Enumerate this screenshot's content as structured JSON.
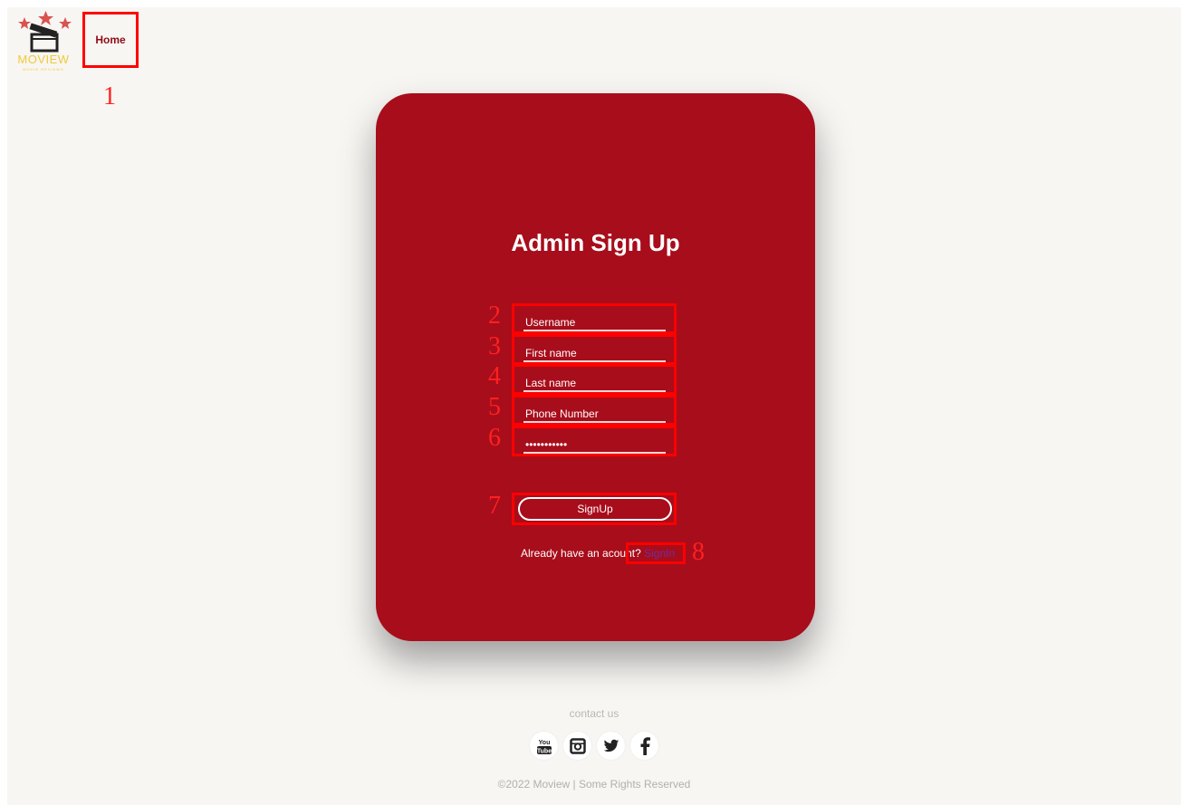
{
  "header": {
    "logo_text": "MOVIEW",
    "logo_subtext": "MOVIE REVIEWS",
    "home_label": "Home"
  },
  "form": {
    "title": "Admin Sign Up",
    "username_placeholder": "Username",
    "firstname_placeholder": "First name",
    "lastname_placeholder": "Last name",
    "phone_placeholder": "Phone Number",
    "password_value": "•••••••••••",
    "signup_label": "SignUp",
    "already_text": "Already have an acount?",
    "signin_label": "SignIn"
  },
  "annotations": [
    "1",
    "2",
    "3",
    "4",
    "5",
    "6",
    "7",
    "8"
  ],
  "footer": {
    "contact_label": "contact us",
    "socials": [
      "youtube-icon",
      "instagram-icon",
      "twitter-icon",
      "facebook-icon"
    ],
    "copyright": "©2022 Moview | Some Rights Reserved"
  },
  "colors": {
    "card": "#a80d1b",
    "background": "#f8f6f3",
    "annotation": "#ff0000",
    "link": "#6b2fa0"
  }
}
